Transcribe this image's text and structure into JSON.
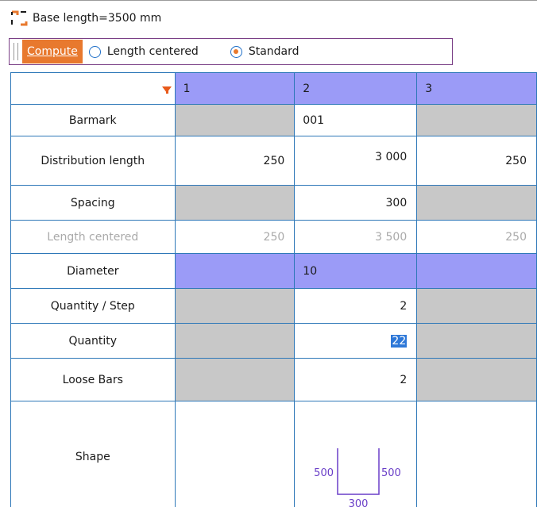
{
  "header": {
    "title": "Base length=3500 mm",
    "icon": "bracket-icon"
  },
  "toolbar": {
    "compute_label": "Compute",
    "options": [
      {
        "label": "Length centered",
        "selected": false
      },
      {
        "label": "Standard",
        "selected": true
      }
    ]
  },
  "grid": {
    "columns": [
      "1",
      "2",
      "3"
    ],
    "rows": {
      "barmark": {
        "label": "Barmark",
        "values": [
          "",
          "001",
          ""
        ]
      },
      "distribution_length": {
        "label": "Distribution length",
        "values": [
          "250",
          "3 000",
          "250"
        ]
      },
      "spacing": {
        "label": "Spacing",
        "values": [
          "",
          "300",
          ""
        ]
      },
      "length_centered": {
        "label": "Length centered",
        "values": [
          "250",
          "3 500",
          "250"
        ]
      },
      "diameter": {
        "label": "Diameter",
        "values": [
          "",
          "10",
          ""
        ]
      },
      "quantity_step": {
        "label": "Quantity / Step",
        "values": [
          "",
          "2",
          ""
        ]
      },
      "quantity": {
        "label": "Quantity",
        "values": [
          "",
          "22",
          ""
        ]
      },
      "loose_bars": {
        "label": "Loose Bars",
        "values": [
          "",
          "2",
          ""
        ]
      },
      "shape": {
        "label": "Shape",
        "left": "500",
        "right": "500",
        "bottom": "300"
      }
    }
  },
  "colors": {
    "accent": "#e8792e",
    "header": "#9b9bf7",
    "grid_line": "#2e78b8",
    "disabled": "#c8c8c8",
    "shape": "#6a3fc8"
  }
}
